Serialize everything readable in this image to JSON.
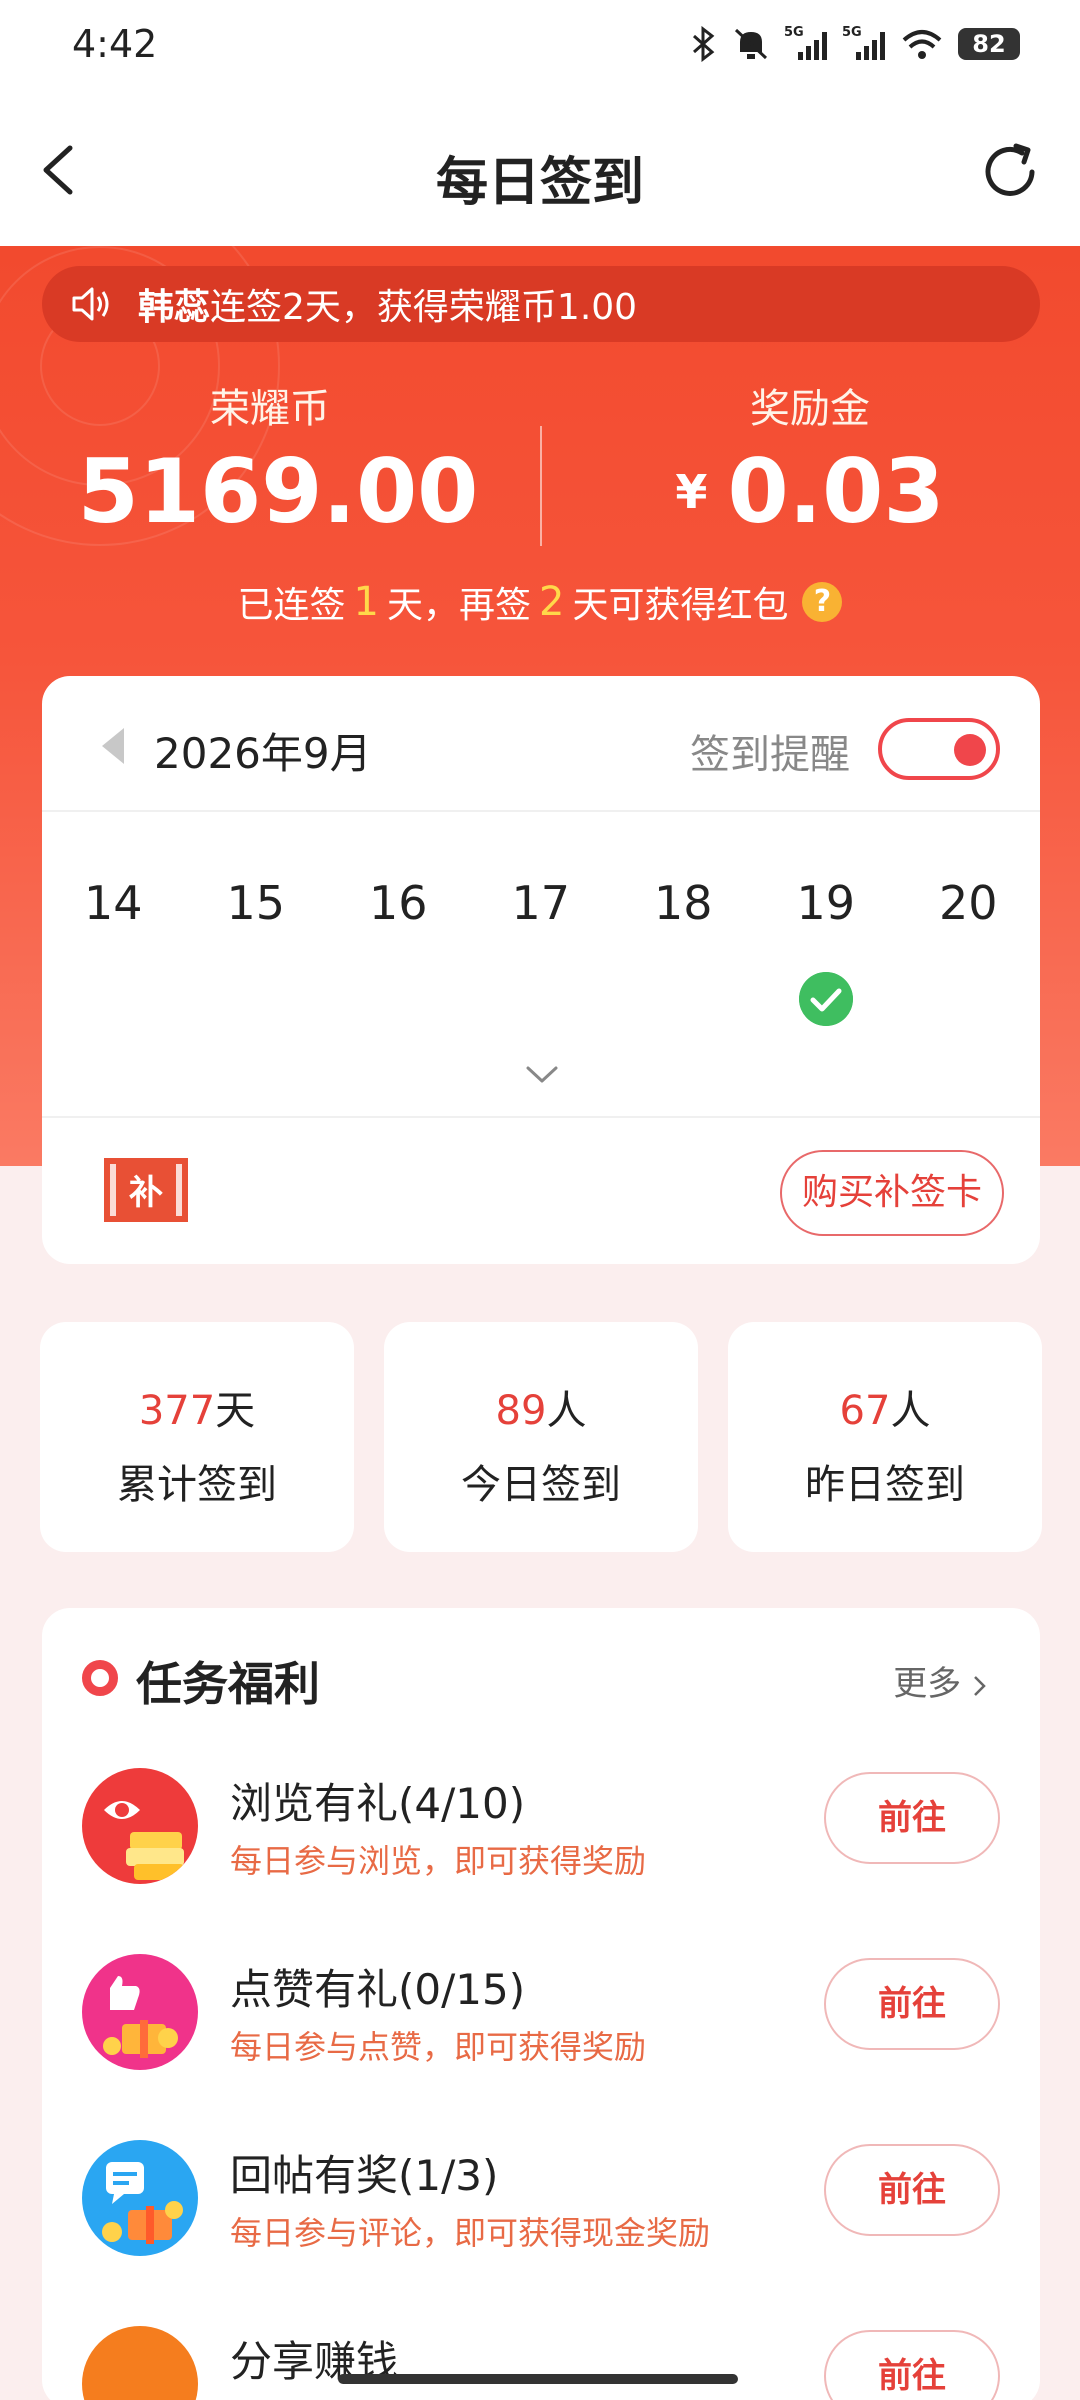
{
  "status_bar": {
    "time": "4:42",
    "network": "5G",
    "battery": "82"
  },
  "header": {
    "title": "每日签到"
  },
  "notice": {
    "name": "韩蕊",
    "text": "连签2天，获得荣耀币1.00"
  },
  "balances": {
    "coins_label": "荣耀币",
    "coins_value": "5169.00",
    "bonus_label": "奖励金",
    "bonus_currency": "¥",
    "bonus_value": "0.03"
  },
  "streak": {
    "part1": "已连签",
    "days_signed": "1",
    "part2": "天，再签",
    "days_remaining": "2",
    "part3": "天可获得红包",
    "help": "?"
  },
  "calendar": {
    "month": "2026年9月",
    "remind_label": "签到提醒",
    "reminder_on": true,
    "days": [
      "14",
      "15",
      "16",
      "17",
      "18",
      "19",
      "20"
    ],
    "checked_day": "19",
    "makeup_icon_char": "补",
    "buy_makeup_label": "购买补签卡"
  },
  "stats": [
    {
      "value": "377",
      "unit": "天",
      "caption": "累计签到"
    },
    {
      "value": "89",
      "unit": "人",
      "caption": "今日签到"
    },
    {
      "value": "67",
      "unit": "人",
      "caption": "昨日签到"
    }
  ],
  "tasks": {
    "title": "任务福利",
    "more": "更多",
    "items": [
      {
        "name": "浏览有礼(4/10)",
        "desc": "每日参与浏览，即可获得奖励",
        "button": "前往",
        "icon": "eye-gift-icon",
        "color": "#ee3b3b"
      },
      {
        "name": "点赞有礼(0/15)",
        "desc": "每日参与点赞，即可获得奖励",
        "button": "前往",
        "icon": "thumbs-up-gift-icon",
        "color": "#f0338a"
      },
      {
        "name": "回帖有奖(1/3)",
        "desc": "每日参与评论，即可获得现金奖励",
        "button": "前往",
        "icon": "comment-gift-icon",
        "color": "#2aa6f2"
      },
      {
        "name": "分享赚钱",
        "desc": "",
        "button": "前往",
        "icon": "share-gift-icon",
        "color": "#f57d1e"
      }
    ]
  }
}
